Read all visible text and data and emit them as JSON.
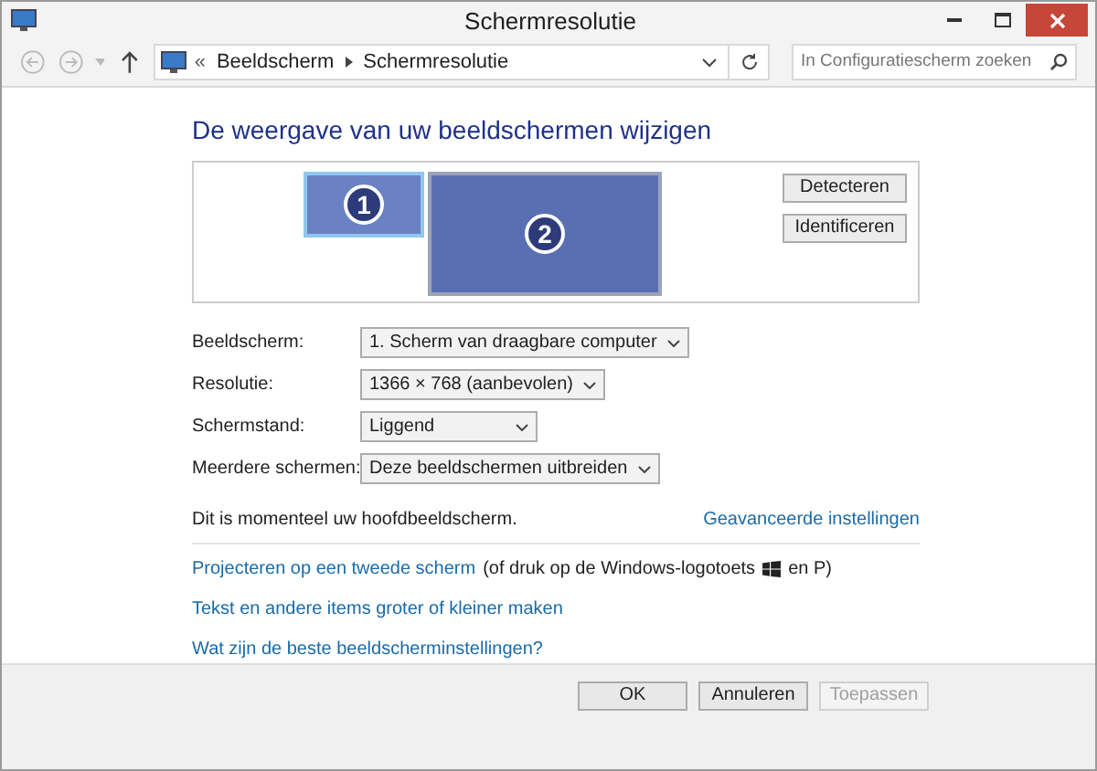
{
  "window": {
    "title": "Schermresolutie"
  },
  "address_bar": {
    "prefix": "«",
    "crumbs": [
      "Beeldscherm",
      "Schermresolutie"
    ]
  },
  "search": {
    "placeholder": "In Configuratiescherm zoeken"
  },
  "heading": "De weergave van uw beeldschermen wijzigen",
  "monitors": [
    {
      "number": "1",
      "selected": true
    },
    {
      "number": "2",
      "selected": false
    }
  ],
  "monitor_buttons": [
    "Detecteren",
    "Identificeren"
  ],
  "settings": [
    {
      "label": "Beeldscherm:",
      "value": "1. Scherm van draagbare computer"
    },
    {
      "label": "Resolutie:",
      "value": "1366 × 768 (aanbevolen)"
    },
    {
      "label": "Schermstand:",
      "value": "Liggend"
    },
    {
      "label": "Meerdere schermen:",
      "value": "Deze beeldschermen uitbreiden"
    }
  ],
  "status_text": "Dit is momenteel uw hoofdbeeldscherm.",
  "advanced_link": "Geavanceerde instellingen",
  "project_line": {
    "link": "Projecteren op een tweede scherm",
    "text_before_icon": "(of druk op de Windows-logotoets",
    "text_after_icon": "en P)"
  },
  "links": [
    "Tekst en andere items groter of kleiner maken",
    "Wat zijn de beste beeldscherminstellingen?"
  ],
  "buttons": [
    {
      "label": "OK",
      "disabled": false
    },
    {
      "label": "Annuleren",
      "disabled": false
    },
    {
      "label": "Toepassen",
      "disabled": true
    }
  ]
}
